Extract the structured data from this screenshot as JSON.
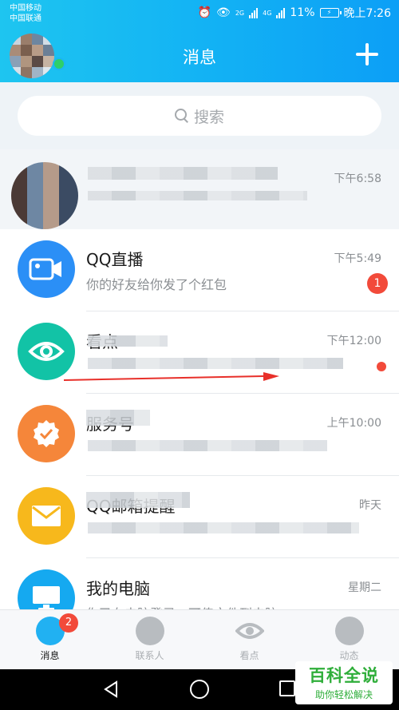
{
  "status_bar": {
    "carrier1": "中国移动",
    "carrier2": "中国联通",
    "net1": "2G",
    "net2": "4G",
    "battery": "11%",
    "battery_icon": "⚡",
    "time": "晚上7:26"
  },
  "header": {
    "title": "消息"
  },
  "search": {
    "placeholder": "搜索"
  },
  "conversations": [
    {
      "name": "",
      "preview": "",
      "time": "下午6:58"
    },
    {
      "name": "QQ直播",
      "preview": "你的好友给你发了个红包",
      "time": "下午5:49",
      "badge": "1"
    },
    {
      "name": "看点",
      "preview": "",
      "time": "下午12:00"
    },
    {
      "name": "服务号",
      "preview": "",
      "time": "上午10:00"
    },
    {
      "name": "QQ邮箱提醒",
      "preview": "",
      "time": "昨天"
    },
    {
      "name": "我的电脑",
      "preview": "你已在电脑登录，可传文件到电脑。",
      "time": "星期二"
    }
  ],
  "tabs": [
    {
      "label": "消息",
      "badge": "2"
    },
    {
      "label": "联系人"
    },
    {
      "label": "看点"
    },
    {
      "label": "动态"
    }
  ],
  "watermark": {
    "main": "百科全说",
    "sub": "助你轻松解决"
  },
  "colors": {
    "header_gradient_start": "#1ec5f0",
    "header_gradient_end": "#0c9ff6",
    "badge_red": "#f24a3a",
    "live_icon": "#2b8ff6",
    "kandian_icon": "#12c3a6",
    "service_icon": "#f5863a",
    "mail_icon": "#f7b81c",
    "computer_icon": "#15a9f0"
  }
}
